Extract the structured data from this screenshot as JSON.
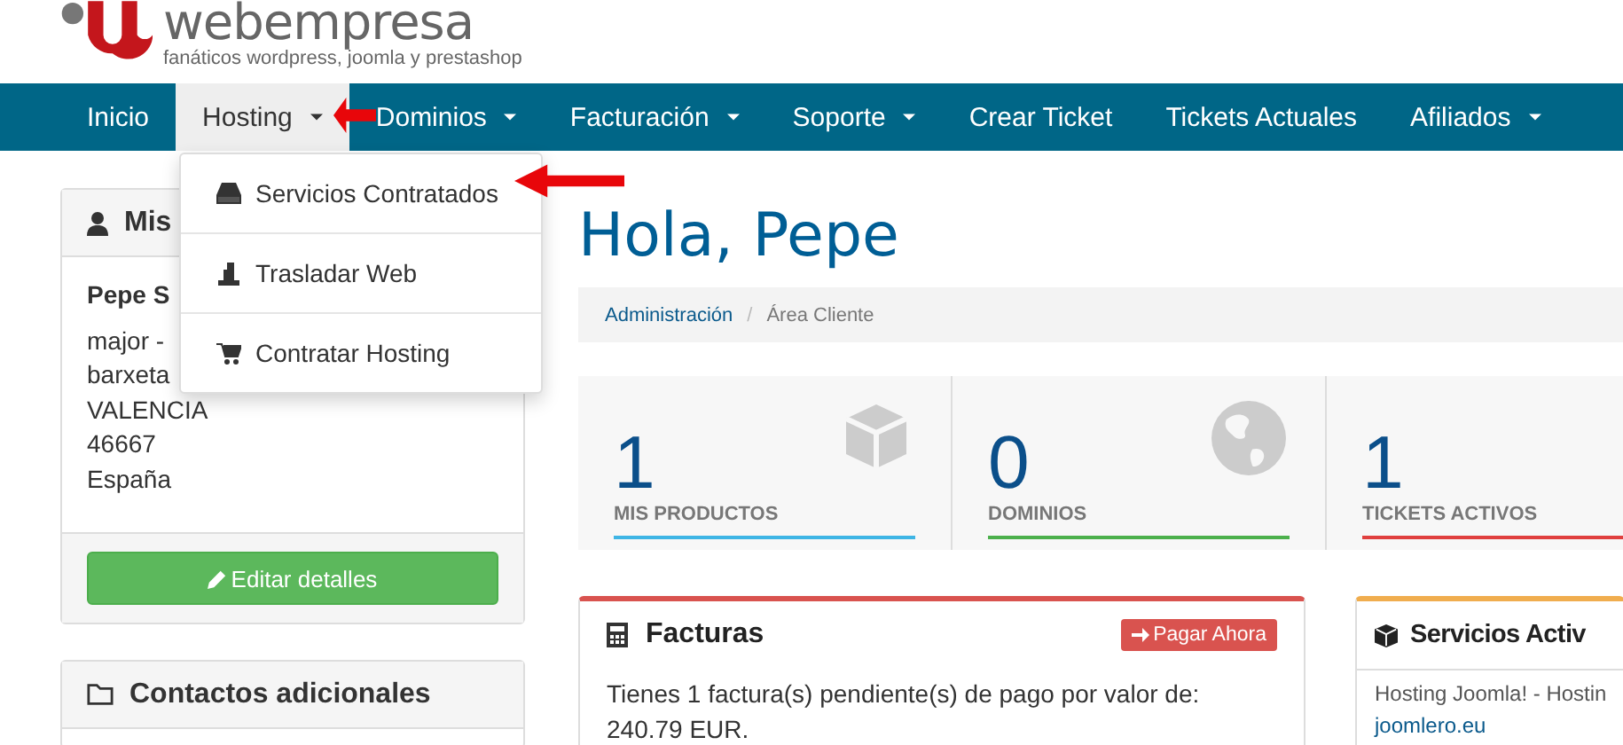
{
  "logo": {
    "name": "webempresa",
    "tagline": "fanáticos wordpress, joomla y prestashop"
  },
  "nav": [
    {
      "label": "Inicio",
      "dropdown": false,
      "selected": false
    },
    {
      "label": "Hosting",
      "dropdown": true,
      "selected": true
    },
    {
      "label": "Dominios",
      "dropdown": true,
      "selected": false
    },
    {
      "label": "Facturación",
      "dropdown": true,
      "selected": false
    },
    {
      "label": "Soporte",
      "dropdown": true,
      "selected": false
    },
    {
      "label": "Crear Ticket",
      "dropdown": false,
      "selected": false
    },
    {
      "label": "Tickets Actuales",
      "dropdown": false,
      "selected": false
    },
    {
      "label": "Afiliados",
      "dropdown": true,
      "selected": false
    }
  ],
  "dropdown_menu": {
    "items": [
      {
        "label": "Servicios Contratados"
      },
      {
        "label": "Trasladar Web"
      },
      {
        "label": "Contratar Hosting"
      }
    ]
  },
  "sidebar": {
    "profile": {
      "title": "Mis",
      "name": "Pepe S",
      "address": [
        "major -",
        "barxeta",
        "VALENCIA",
        "46667",
        "España"
      ],
      "button": "Editar detalles"
    },
    "contacts": {
      "title": "Contactos adicionales"
    }
  },
  "greeting": "Hola, Pepe",
  "breadcrumb_separator": "/",
  "breadcrumb": [
    {
      "label": "Administración",
      "link": true
    },
    {
      "label": "Área Cliente",
      "link": false
    }
  ],
  "stats": [
    {
      "value": "1",
      "label": "MIS PRODUCTOS",
      "color": "#3fb5e5"
    },
    {
      "value": "0",
      "label": "DOMINIOS",
      "color": "#4cb04c"
    },
    {
      "value": "1",
      "label": "TICKETS ACTIVOS",
      "color": "#e0403f"
    }
  ],
  "invoices": {
    "title": "Facturas",
    "button": "Pagar Ahora",
    "text": "Tienes 1 factura(s) pendiente(s) de pago por valor de: 240.79 EUR."
  },
  "services": {
    "title": "Servicios Activ",
    "item": "Hosting Joomla! - Hostin",
    "link": "joomlero.eu"
  }
}
